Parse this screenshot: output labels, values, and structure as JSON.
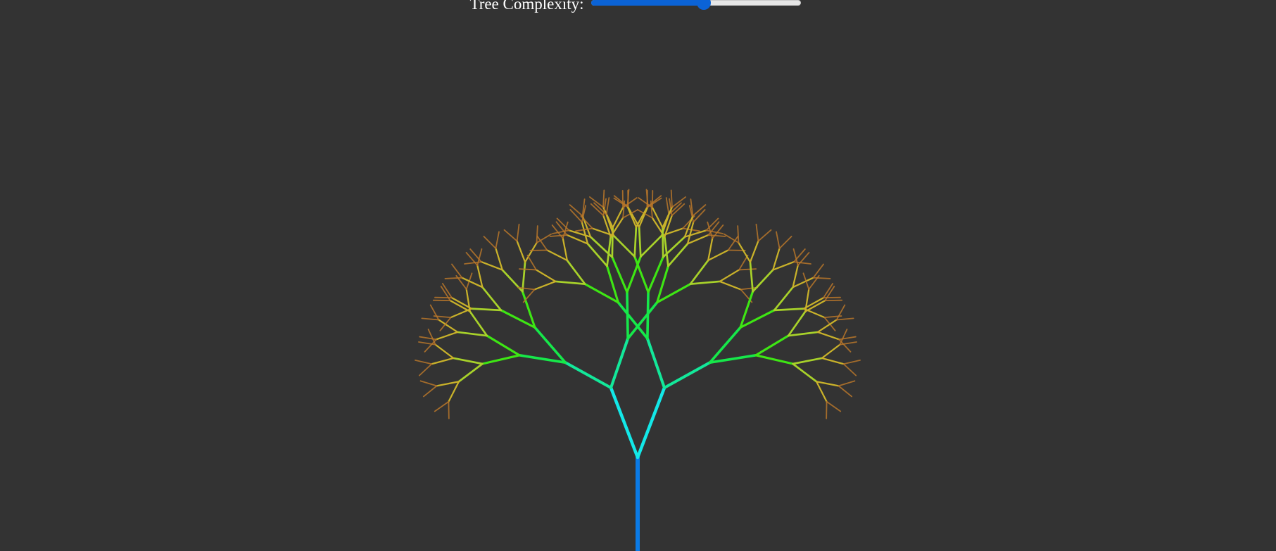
{
  "controls": {
    "complexity_label": "Tree Complexity:",
    "complexity_value": 0.54
  },
  "tree": {
    "depth": 7,
    "colors": {
      "trunk": "#0a7ae6",
      "level1": "#13e8e8",
      "level2": "#13e89a",
      "level3": "#16e84a",
      "level4": "#3ee614",
      "level5": "#a8d22a",
      "level6": "#c9b22a",
      "level7": "#b8772a"
    },
    "background": "#333333",
    "accent": "#0b63d6"
  }
}
